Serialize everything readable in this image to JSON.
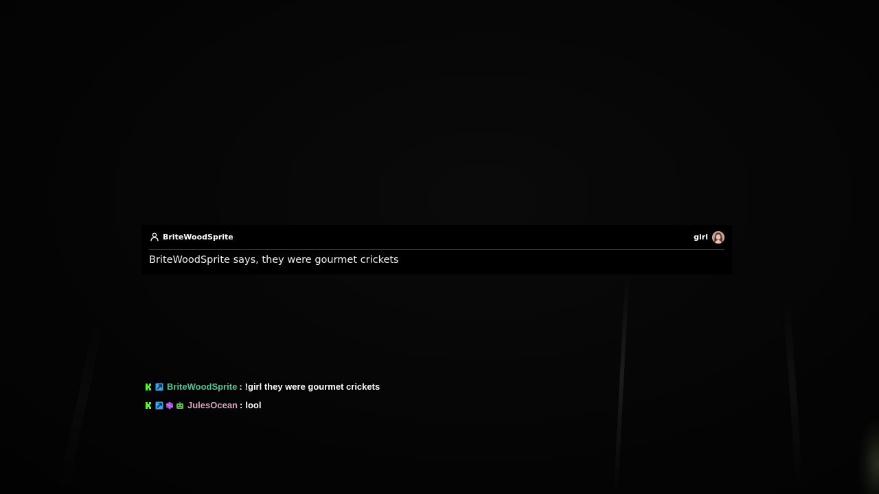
{
  "tts_alert": {
    "sender": "BriteWoodSprite",
    "voice": "girl",
    "message": "BriteWoodSprite says, they were gourmet crickets"
  },
  "chat": {
    "separator": ":",
    "messages": [
      {
        "username": "BriteWoodSprite",
        "username_color": "#48c9a0",
        "badges": [
          "kick-k-badge",
          "blue-boost-badge"
        ],
        "text": "!girl they were gourmet crickets"
      },
      {
        "username": "JulesOcean",
        "username_color": "#d6a8c0",
        "badges": [
          "kick-k-badge",
          "blue-boost-badge",
          "purple-gem-badge",
          "green-robot-badge"
        ],
        "text": "lool"
      }
    ]
  },
  "colors": {
    "kick_green": "#53fc18",
    "boost_blue": "#3aa3e8",
    "gem_purple": "#a24bd6",
    "robot_green": "#5fb84a"
  }
}
